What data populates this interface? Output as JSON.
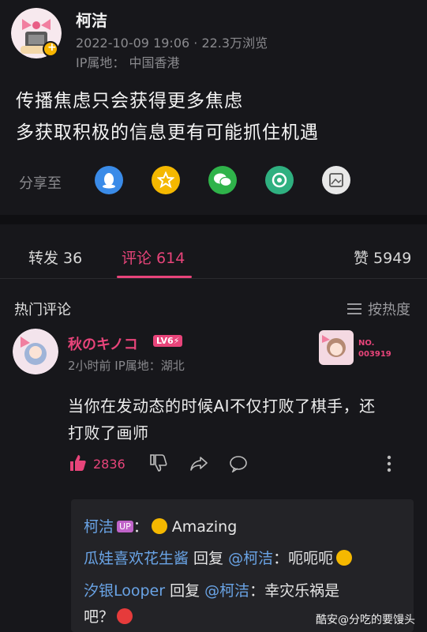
{
  "post": {
    "author": "柯洁",
    "meta": "2022-10-09 19:06 · 22.3万浏览",
    "ip": "IP属地： 中国香港",
    "lines": [
      "传播焦虑只会获得更多焦虑",
      "多获取积极的信息更有可能抓住机遇"
    ]
  },
  "share": {
    "label": "分享至",
    "targets": [
      {
        "icon": "qq-icon",
        "color": "#3a8be8"
      },
      {
        "icon": "qzone-star-icon",
        "color": "#f5b800"
      },
      {
        "icon": "wechat-icon",
        "color": "#2fb34a"
      },
      {
        "icon": "moments-icon",
        "color": "#2fb080"
      },
      {
        "icon": "gallery-icon",
        "color": "#e8e8e8"
      }
    ]
  },
  "tabs": {
    "repost": "转发 36",
    "comments": "评论 614",
    "likes": "赞 5949"
  },
  "hot": {
    "label": "热门评论",
    "sort": "按热度"
  },
  "comment": {
    "name": "秋のキノコ",
    "level": "LV6⚡",
    "meta": "2小时前  IP属地：湖北",
    "lines": [
      "当你在发动态的时候AI不仅打败了棋手，还",
      "打败了画师"
    ],
    "badge_no": "NO.",
    "badge_num": "003919",
    "likes": "2836"
  },
  "replies": [
    {
      "name": "柯洁",
      "tag": "UP",
      "sep": "：",
      "text": "Amazing"
    },
    {
      "name": "瓜娃喜欢花生酱",
      "verb": " 回复 ",
      "mention": "@柯洁",
      "text": "：呃呃呃"
    },
    {
      "name": "汐银Looper",
      "verb": " 回复 ",
      "mention": "@柯洁",
      "text": "：幸灾乐祸是"
    },
    {
      "text": "吧？"
    }
  ],
  "watermark": "酷安@分吃的要馒头"
}
